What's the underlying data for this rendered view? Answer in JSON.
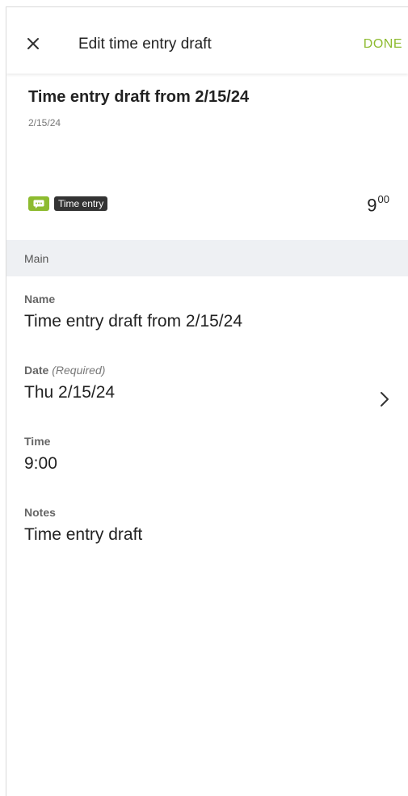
{
  "header": {
    "title": "Edit time entry draft",
    "done_label": "DONE",
    "close_icon": "close-icon",
    "accent_color": "#8dbb2f"
  },
  "summary": {
    "title": "Time entry draft from 2/15/24",
    "date": "2/15/24",
    "type_icon": "comment-icon",
    "type_label": "Time entry",
    "duration_hours": "9",
    "duration_minutes": "00"
  },
  "section": {
    "title": "Main"
  },
  "fields": {
    "name": {
      "label": "Name",
      "value": "Time entry draft from 2/15/24"
    },
    "date": {
      "label": "Date",
      "required_text": "(Required)",
      "value": "Thu 2/15/24"
    },
    "time": {
      "label": "Time",
      "value": "9:00"
    },
    "notes": {
      "label": "Notes",
      "value": "Time entry draft"
    }
  }
}
